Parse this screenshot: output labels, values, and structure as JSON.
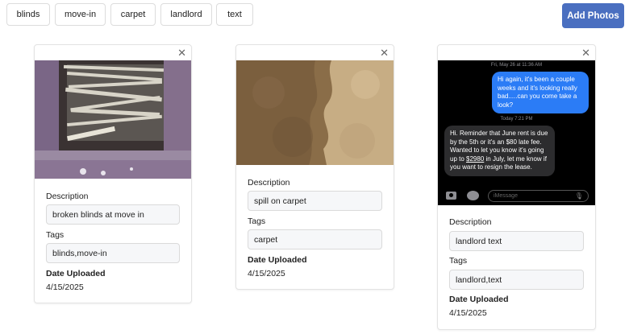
{
  "filters": {
    "tags": [
      "blinds",
      "move-in",
      "carpet",
      "landlord",
      "text"
    ]
  },
  "toolbar": {
    "add_label": "Add Photos"
  },
  "labels": {
    "description": "Description",
    "tags": "Tags",
    "date_uploaded": "Date Uploaded"
  },
  "cards": [
    {
      "description": "broken blinds at move in",
      "tags": "blinds,move-in",
      "date": "4/15/2025"
    },
    {
      "description": "spill on carpet",
      "tags": "carpet",
      "date": "4/15/2025"
    },
    {
      "description": "landlord text",
      "tags": "landlord,text",
      "date": "4/15/2025"
    }
  ],
  "sms": {
    "stamp1": "Fri, May 26 at 11:36 AM",
    "outgoing": "Hi again, it's been a couple weeks and it's looking really bad.....can you come take a look?",
    "stamp2": "Today 7:21 PM",
    "incoming_before": "Hi. Reminder that June rent is due by the 5th or it's an $80 late fee. Wanted to let you know it's going up to ",
    "incoming_amount": "$2980",
    "incoming_after": " in July, let me know if you want to resign the lease.",
    "input_placeholder": "iMessage"
  }
}
